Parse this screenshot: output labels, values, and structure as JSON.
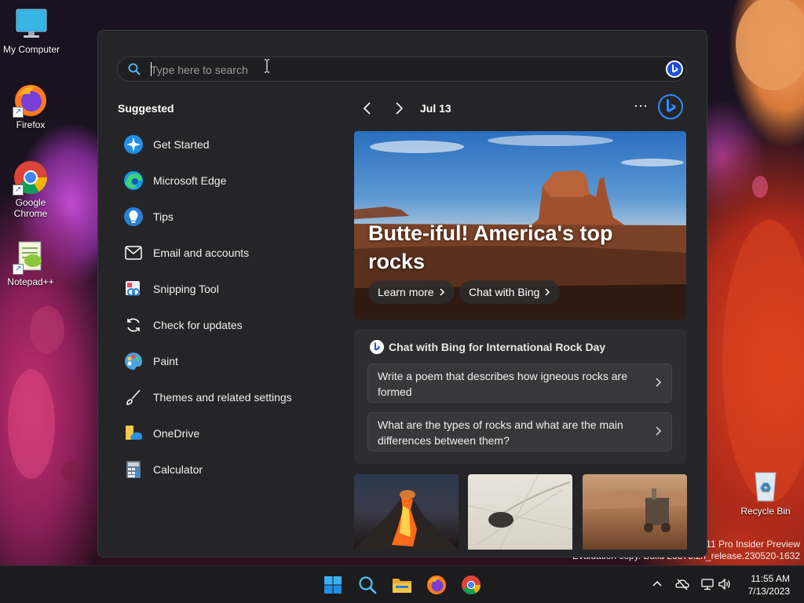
{
  "desktop": {
    "icons": [
      {
        "label": "My Computer"
      },
      {
        "label": "Firefox"
      },
      {
        "label": "Google Chrome"
      },
      {
        "label": "Notepad++"
      },
      {
        "label": "Recycle Bin"
      }
    ]
  },
  "search": {
    "placeholder": "Type here to search"
  },
  "suggested": {
    "title": "Suggested",
    "items": [
      {
        "label": "Get Started",
        "icon": "get-started-icon"
      },
      {
        "label": "Microsoft Edge",
        "icon": "edge-icon"
      },
      {
        "label": "Tips",
        "icon": "tips-icon"
      },
      {
        "label": "Email and accounts",
        "icon": "mail-icon"
      },
      {
        "label": "Snipping Tool",
        "icon": "snipping-tool-icon"
      },
      {
        "label": "Check for updates",
        "icon": "refresh-icon"
      },
      {
        "label": "Paint",
        "icon": "paint-icon"
      },
      {
        "label": "Themes and related settings",
        "icon": "brush-icon"
      },
      {
        "label": "OneDrive",
        "icon": "onedrive-icon"
      },
      {
        "label": "Calculator",
        "icon": "calculator-icon"
      }
    ]
  },
  "highlights": {
    "date": "Jul 13",
    "more": "···",
    "hero": {
      "title": "Butte-iful! America's top rocks",
      "learn_more": "Learn more",
      "chat_with_bing": "Chat with Bing"
    },
    "chat_card": {
      "title": "Chat with Bing for International Rock Day",
      "prompts": [
        "Write a poem that describes how igneous rocks are formed",
        "What are the types of rocks and what are the main differences between them?"
      ]
    },
    "thumbnails": [
      "volcano-thumbnail",
      "sailing-stone-thumbnail",
      "mars-rover-thumbnail"
    ]
  },
  "watermark": {
    "line1": "s 11 Pro Insider Preview",
    "line2": "Evaluation copy. Build 25375.zn_release.230520-1632"
  },
  "taskbar": {
    "apps": [
      "windows-start-icon",
      "search-icon",
      "file-explorer-icon",
      "firefox-icon",
      "chrome-icon"
    ],
    "tray": [
      "chevron-up-icon",
      "onedrive-offline-icon",
      "network-icon",
      "volume-icon"
    ],
    "time": "11:55 AM",
    "date": "7/13/2023"
  },
  "colors": {
    "panel_bg": "#252527",
    "accent_blue": "#2e8bff",
    "taskbar_bg": "#1c1c1e"
  }
}
